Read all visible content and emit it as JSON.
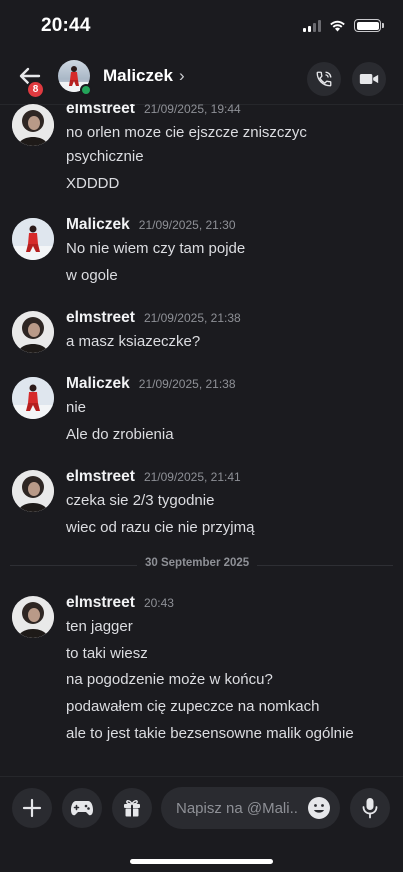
{
  "status_bar": {
    "time": "20:44"
  },
  "header": {
    "title": "Maliczek",
    "unread_badge": "8"
  },
  "messages": [
    {
      "author": "elmstreet",
      "timestamp": "21/09/2025, 19:44",
      "lines": [
        "no orlen moze cie ejszcze zniszczyc",
        "psychicznie",
        "XDDDD"
      ]
    },
    {
      "author": "Maliczek",
      "timestamp": "21/09/2025, 21:30",
      "lines": [
        "No nie wiem czy tam pojde",
        "w ogole"
      ]
    },
    {
      "author": "elmstreet",
      "timestamp": "21/09/2025, 21:38",
      "lines": [
        "a masz ksiazeczke?"
      ]
    },
    {
      "author": "Maliczek",
      "timestamp": "21/09/2025, 21:38",
      "lines": [
        "nie",
        "Ale do zrobienia"
      ]
    },
    {
      "author": "elmstreet",
      "timestamp": "21/09/2025, 21:41",
      "lines": [
        "czeka sie 2/3 tygodnie",
        "wiec od razu cie nie przyjmą"
      ]
    },
    {
      "author": "elmstreet",
      "timestamp": "20:43",
      "lines": [
        "ten jagger",
        "to taki wiesz",
        "na pogodzenie może w końcu?",
        "podawałem cię zupeczce na nomkach",
        "ale to jest takie bezsensowne malik ogólnie"
      ]
    }
  ],
  "date_separator": "30 September 2025",
  "composer": {
    "placeholder": "Napisz na @Mali.."
  },
  "icons": {
    "back": "back-arrow-icon",
    "call": "phone-icon",
    "video": "video-camera-icon",
    "plus": "plus-icon",
    "game": "gamepad-icon",
    "gift": "gift-icon",
    "emoji": "emoji-icon",
    "mic": "microphone-icon"
  },
  "colors": {
    "background": "#1b1b1f",
    "online": "#23a55a",
    "badge": "#e03a40"
  }
}
